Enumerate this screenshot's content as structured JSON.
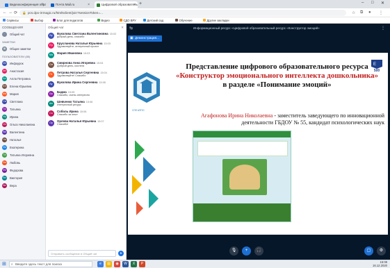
{
  "browser": {
    "tabs": [
      {
        "label": "Видеоконференция образовательн...",
        "color": "#1a73e8"
      },
      {
        "label": "Почта Mail.ru",
        "color": "#0a5dc2"
      },
      {
        "label": "Цифровой образовательный ресурс",
        "color": "#2e7d32"
      }
    ],
    "active_tab_index": 2,
    "new_tab": "+",
    "window_controls": [
      "–",
      "□",
      "✕"
    ],
    "url": "pcs.dpo-irrmagic.ru/html5client/join?sessionToken=...",
    "bookmarks": [
      {
        "label": "Сервисы",
        "color": "#4a8af4"
      },
      {
        "label": "Выбор",
        "color": "#e53935"
      },
      {
        "label": "Блог для педагогов",
        "color": "#8e24aa"
      },
      {
        "label": "Видео",
        "color": "#43a047"
      },
      {
        "label": "СДО ВРУ",
        "color": "#fb8c00"
      },
      {
        "label": "Детский сад",
        "color": "#1e88e5"
      },
      {
        "label": "Обучение",
        "color": "#6d4c41"
      },
      {
        "label": "Другие закладки",
        "color": "#f9a825"
      }
    ]
  },
  "users_panel": {
    "header": "СООБЩЕНИЯ",
    "sections": [
      "Общий чат",
      "ЗАМЕТКИ",
      "Общие заметки",
      "ПОЛЬЗОВАТЕЛИ (85)"
    ],
    "users": [
      {
        "initials": "Ин",
        "name": "Инфоурок",
        "color": "#3f51b5"
      },
      {
        "initials": "Ан",
        "name": "Анастасия",
        "color": "#e91e63"
      },
      {
        "initials": "Ал",
        "name": "Алла Петровна",
        "color": "#009688"
      },
      {
        "initials": "Ел",
        "name": "Елена Юрьевна",
        "color": "#795548"
      },
      {
        "initials": "Ма",
        "name": "Мария",
        "color": "#ff5722"
      },
      {
        "initials": "Св",
        "name": "Светлана",
        "color": "#3949ab"
      },
      {
        "initials": "Та",
        "name": "Татьяна",
        "color": "#8e24aa"
      },
      {
        "initials": "Ир",
        "name": "Ирина",
        "color": "#00897b"
      },
      {
        "initials": "Ол",
        "name": "Ольга Николаевна",
        "color": "#c2185b"
      },
      {
        "initials": "Ва",
        "name": "Валентина",
        "color": "#5e35b1"
      },
      {
        "initials": "На",
        "name": "Наталья",
        "color": "#6d4c41"
      },
      {
        "initials": "Ек",
        "name": "Екатерина",
        "color": "#1e88e5"
      },
      {
        "initials": "Та",
        "name": "Татьяна Игоревна",
        "color": "#43a047"
      },
      {
        "initials": "Лю",
        "name": "Любовь",
        "color": "#f4511e"
      },
      {
        "initials": "Фе",
        "name": "Федорова",
        "color": "#7b1fa2"
      },
      {
        "initials": "Ви",
        "name": "Виктория",
        "color": "#00838f"
      },
      {
        "initials": "Ве",
        "name": "Вера",
        "color": "#ad1457"
      }
    ]
  },
  "chat": {
    "header": "Общий чат",
    "close": "✕",
    "messages": [
      {
        "initials": "Ву",
        "name": "Вуколова Светлана Валентиновна",
        "time": "15:02",
        "text": "добрый день, спасибо",
        "color": "#3f51b5"
      },
      {
        "initials": "Ер",
        "name": "Ерусланова Наталья Юрьевна",
        "time": "15:03",
        "text": "Здравствуйте, интересный проект",
        "color": "#e91e63"
      },
      {
        "initials": "Ма",
        "name": "Мария Ивановна",
        "time": "15:03",
        "text": "",
        "color": "#009688"
      },
      {
        "initials": "См",
        "name": "Смирнова Анна Игоревна",
        "time": "15:04",
        "text": "Добрый день, коллеги",
        "color": "#795548"
      },
      {
        "initials": "Пт",
        "name": "Петрова Наталья Сергеевна",
        "time": "15:04",
        "text": "Здравствуйте! Спасибо",
        "color": "#ff5722"
      },
      {
        "initials": "Ву",
        "name": "Вуколова Ирина Сергеевна",
        "time": "15:05",
        "text": "",
        "color": "#3949ab"
      },
      {
        "initials": "Ба",
        "name": "Бадма",
        "time": "15:05",
        "text": "Спасибо, очень интересно",
        "color": "#8e24aa"
      },
      {
        "initials": "Ше",
        "name": "Шевченко Татьяна",
        "time": "15:06",
        "text": "Интересный ресурс",
        "color": "#00897b"
      },
      {
        "initials": "Со",
        "name": "Соболь Ирина",
        "time": "15:06",
        "text": "Спасибо за опыт",
        "color": "#c2185b"
      },
      {
        "initials": "Ор",
        "name": "Орлова Наталья Юрьевна",
        "time": "15:07",
        "text": "Спасибо!",
        "color": "#5e35b1"
      }
    ],
    "input_placeholder": "Отправить сообщение в Общий чат",
    "send_icon": "➤"
  },
  "main": {
    "title": "Информационный ресурс «Цифровой образовательный ресурс «Конструктор эмоций»",
    "presenter_label": "Демонстрация...",
    "slide": {
      "title_line1": "Представление цифрового образовательного ресурса",
      "title_line2": "«Конструктор эмоционального интеллекта дошкольника»",
      "title_line3": "в разделе «Понимание эмоций»",
      "author_name": "Агафонова Ирина Николаевна",
      "author_role": " - заместитель заведующего по инновационной деятельности ГБДОУ № 55, кандидат психологических наук",
      "logo_text": "500"
    }
  },
  "taskbar": {
    "search_placeholder": "Введите здесь текст для поиска",
    "clock": "15:08",
    "date": "16.12.2020",
    "apps": [
      {
        "color": "#3b7de0",
        "glyph": "e"
      },
      {
        "color": "#f2b705",
        "glyph": "▤"
      },
      {
        "color": "#db4437",
        "glyph": "◉"
      },
      {
        "color": "#2b579a",
        "glyph": "W"
      },
      {
        "color": "#217346",
        "glyph": "X"
      },
      {
        "color": "#d24726",
        "glyph": "P"
      }
    ]
  }
}
